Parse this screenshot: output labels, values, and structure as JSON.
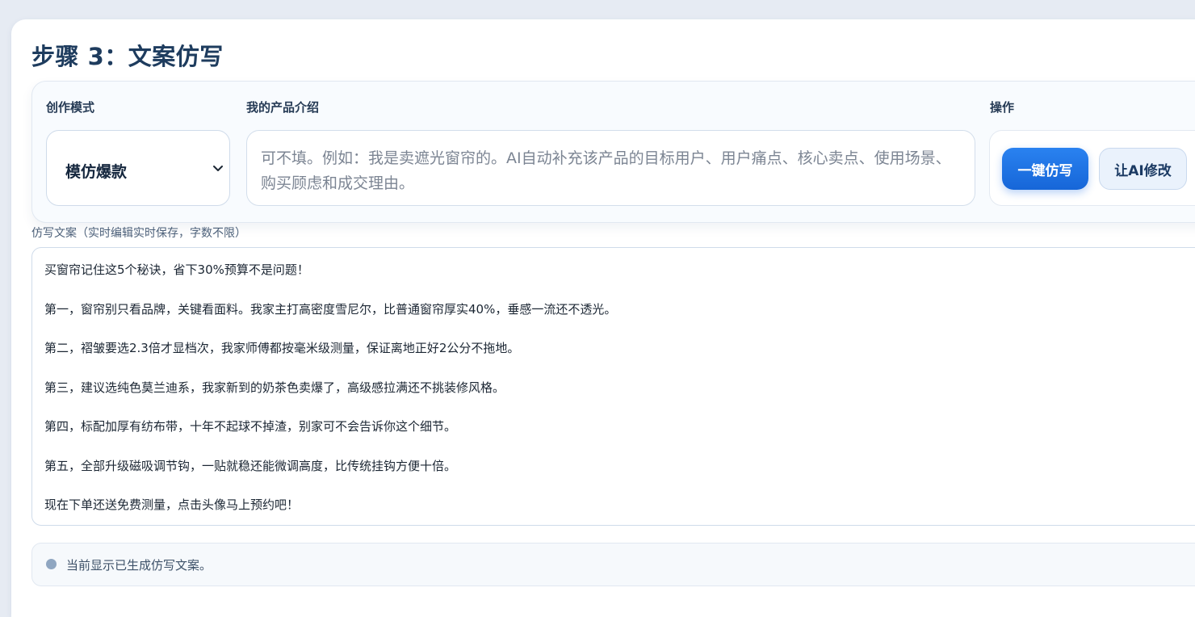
{
  "step": {
    "title": "步骤 3：文案仿写"
  },
  "mode": {
    "label": "创作模式",
    "selected": "模仿爆款"
  },
  "intro": {
    "label": "我的产品介绍",
    "placeholder": "可不填。例如：我是卖遮光窗帘的。AI自动补充该产品的目标用户、用户痛点、核心卖点、使用场景、购买顾虑和成交理由。"
  },
  "actions": {
    "label": "操作",
    "primary": "一键仿写",
    "secondary": "让AI修改"
  },
  "copy": {
    "label": "仿写文案（实时编辑实时保存，字数不限）",
    "lines": [
      "买窗帘记住这5个秘诀，省下30%预算不是问题！",
      "第一，窗帘别只看品牌，关键看面料。我家主打高密度雪尼尔，比普通窗帘厚实40%，垂感一流还不透光。",
      "第二，褶皱要选2.3倍才显档次，我家师傅都按毫米级测量，保证离地正好2公分不拖地。",
      "第三，建议选纯色莫兰迪系，我家新到的奶茶色卖爆了，高级感拉满还不挑装修风格。",
      "第四，标配加厚有纺布带，十年不起球不掉渣，别家可不会告诉你这个细节。",
      "第五，全部升级磁吸调节钩，一贴就稳还能微调高度，比传统挂钩方便十倍。",
      "现在下单还送免费测量，点击头像马上预约吧！"
    ]
  },
  "status": {
    "text": "当前显示已生成仿写文案。"
  }
}
